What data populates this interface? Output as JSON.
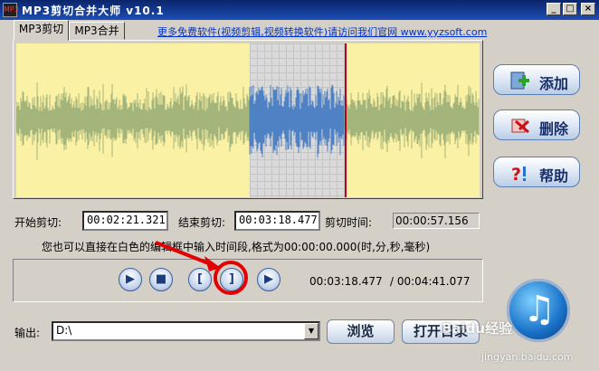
{
  "window": {
    "title": "MP3剪切合并大师 v10.1",
    "icon_text": "MP3"
  },
  "controls": {
    "minimize": "_",
    "maximize": "□",
    "close": "×"
  },
  "tabs": [
    {
      "label": "MP3剪切",
      "active": true
    },
    {
      "label": "MP3合并",
      "active": false
    }
  ],
  "promo_link": "更多免费软件(视频剪辑,视频转换软件)请访问我们官网 www.yyzsoft.com",
  "side_buttons": {
    "add": "添加",
    "delete": "删除",
    "help": "帮助"
  },
  "time": {
    "start_label": "开始剪切:",
    "start_value": "00:02:21.321",
    "end_label": "结束剪切:",
    "end_value": "00:03:18.477",
    "cut_label": "剪切时间:",
    "cut_value": "00:00:57.156"
  },
  "hint": "您也可以直接在白色的编辑框中输入时间段,格式为00:00:00.000(时,分,秒,毫秒)",
  "playback": {
    "current": "00:03:18.477",
    "total": "/ 00:04:41.077"
  },
  "transport_icons": [
    "play-icon",
    "stop-icon",
    "set-start-icon",
    "set-end-icon",
    "preview-selection-icon"
  ],
  "output": {
    "label": "输出:",
    "path": "D:\\"
  },
  "buttons": {
    "browse": "浏览",
    "open_dir": "打开目录"
  },
  "watermark": {
    "brand": "Baidu经验",
    "url": "jingyan.baidu.com"
  },
  "colors": {
    "wave_bg": "#fbf1a4",
    "wave_outer": "#a3b57a",
    "wave_selected": "#4f82c4",
    "cursor": "#c00018",
    "annotation": "#e00000"
  }
}
